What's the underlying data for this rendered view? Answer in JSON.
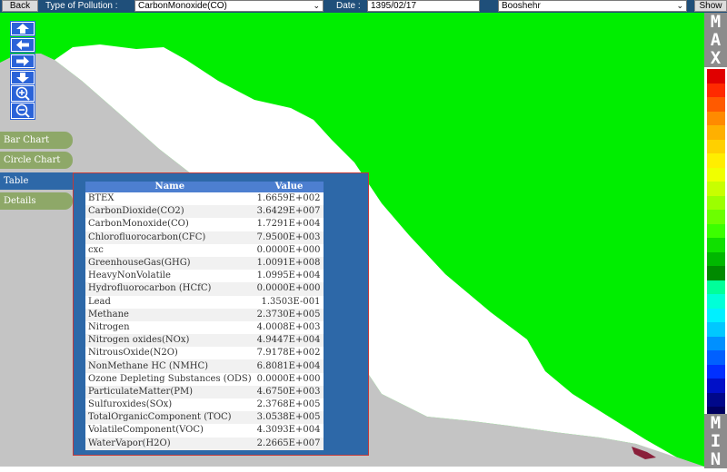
{
  "toolbar": {
    "back_label": "Back",
    "pollution_label": "Type of Pollution :",
    "pollution_value": "CarbonMonoxide(CO)",
    "date_label": "Date :",
    "date_value": "1395/02/17",
    "region_value": "Booshehr",
    "show_label": "Show"
  },
  "side_tabs": [
    "Bar Chart",
    "Circle Chart",
    "Table",
    "Details"
  ],
  "active_tab": "Table",
  "table": {
    "headers": [
      "Name",
      "Value"
    ],
    "rows": [
      [
        "BTEX",
        "1.6659E+002"
      ],
      [
        "CarbonDioxide(CO2)",
        "3.6429E+007"
      ],
      [
        "CarbonMonoxide(CO)",
        "1.7291E+004"
      ],
      [
        "Chlorofluorocarbon(CFC)",
        "7.9500E+003"
      ],
      [
        "cxc",
        "0.0000E+000"
      ],
      [
        "GreenhouseGas(GHG)",
        "1.0091E+008"
      ],
      [
        "HeavyNonVolatile",
        "1.0995E+004"
      ],
      [
        "Hydrofluorocarbon (HCfC)",
        "0.0000E+000"
      ],
      [
        "Lead",
        "1.3503E-001"
      ],
      [
        "Methane",
        "2.3730E+005"
      ],
      [
        "Nitrogen",
        "4.0008E+003"
      ],
      [
        "Nitrogen oxides(NOx)",
        "4.9447E+004"
      ],
      [
        "NitrousOxide(N2O)",
        "7.9178E+002"
      ],
      [
        "NonMethane HC (NMHC)",
        "6.8081E+004"
      ],
      [
        "Ozone Depleting Substances (ODS)",
        "0.0000E+000"
      ],
      [
        "ParticulateMatter(PM)",
        "4.6750E+003"
      ],
      [
        "Sulfuroxides(SOx)",
        "2.3768E+005"
      ],
      [
        "TotalOrganicComponent (TOC)",
        "3.0538E+005"
      ],
      [
        "VolatileComponent(VOC)",
        "4.3093E+004"
      ],
      [
        "WaterVapor(H2O)",
        "2.2665E+007"
      ]
    ]
  },
  "legend": {
    "max_letters": [
      "M",
      "A",
      "X"
    ],
    "min_letters": [
      "M",
      "I",
      "N"
    ],
    "colors": [
      "#e00000",
      "#ff2a00",
      "#ff5a00",
      "#ff8a00",
      "#ffb000",
      "#ffd000",
      "#ffee00",
      "#f0ff00",
      "#c8ff00",
      "#9cff00",
      "#6cff00",
      "#3cff00",
      "#10e000",
      "#00b800",
      "#008a00",
      "#00ff9a",
      "#00ffd8",
      "#00f0ff",
      "#00c8ff",
      "#0090ff",
      "#0060ff",
      "#0030ff",
      "#0010c8",
      "#00088a",
      "#000060"
    ]
  },
  "colors": {
    "map_green": "#00ee00",
    "sea_white": "#ffffff",
    "land_gray": "#c4c4c4",
    "panel_blue": "#2d68a8",
    "nav_blue": "#2a63d8",
    "tab_green": "#8ea868",
    "toolbar_blue": "#1f4f7a"
  },
  "icons": {
    "nav": [
      "arrow-up-icon",
      "arrow-left-icon",
      "arrow-right-icon",
      "arrow-down-icon"
    ],
    "zoom": [
      "zoom-in-icon",
      "zoom-out-icon"
    ]
  }
}
